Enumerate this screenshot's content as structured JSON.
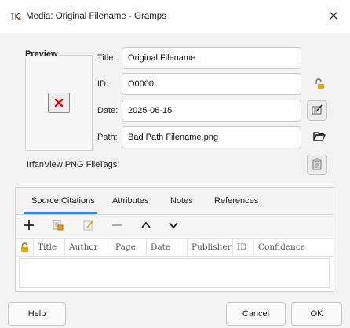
{
  "window": {
    "title": "Media: Original Filename - Gramps",
    "app_icon": "gramps-icon",
    "close_icon": "close-icon"
  },
  "preview": {
    "label": "Preview",
    "image_icon": "broken-image-icon"
  },
  "fields": {
    "title": {
      "label": "Title:",
      "value": "Original Filename",
      "action_icon": "lock-icon"
    },
    "id": {
      "label": "ID:",
      "value": "O0000",
      "action_icon": "padlock-icon"
    },
    "date": {
      "label": "Date:",
      "value": "2025-06-15",
      "action_icon": "edit-date-icon"
    },
    "path": {
      "label": "Path:",
      "value": "Bad Path Filename.png",
      "action_icon": "folder-open-icon"
    },
    "tags": {
      "label": "Tags:",
      "action_icon": "tag-edit-icon"
    }
  },
  "mime_type": "IrfanView PNG File",
  "notebook": {
    "tabs": [
      {
        "label": "Source Citations",
        "active": true
      },
      {
        "label": "Attributes",
        "active": false
      },
      {
        "label": "Notes",
        "active": false
      },
      {
        "label": "References",
        "active": false
      }
    ],
    "toolbar": [
      "add-icon",
      "share-existing-icon",
      "edit-icon",
      "remove-icon",
      "move-up-icon",
      "move-down-icon"
    ],
    "columns": [
      "Title",
      "Author",
      "Page",
      "Date",
      "Publisher",
      "ID",
      "Confidence"
    ],
    "private_column_icon": "lock-icon",
    "rows": []
  },
  "buttons": {
    "help": "Help",
    "cancel": "Cancel",
    "ok": "OK"
  },
  "colors": {
    "accent": "#3584e4",
    "error_red": "#d60000",
    "lock_yellow": "#e0a800"
  }
}
